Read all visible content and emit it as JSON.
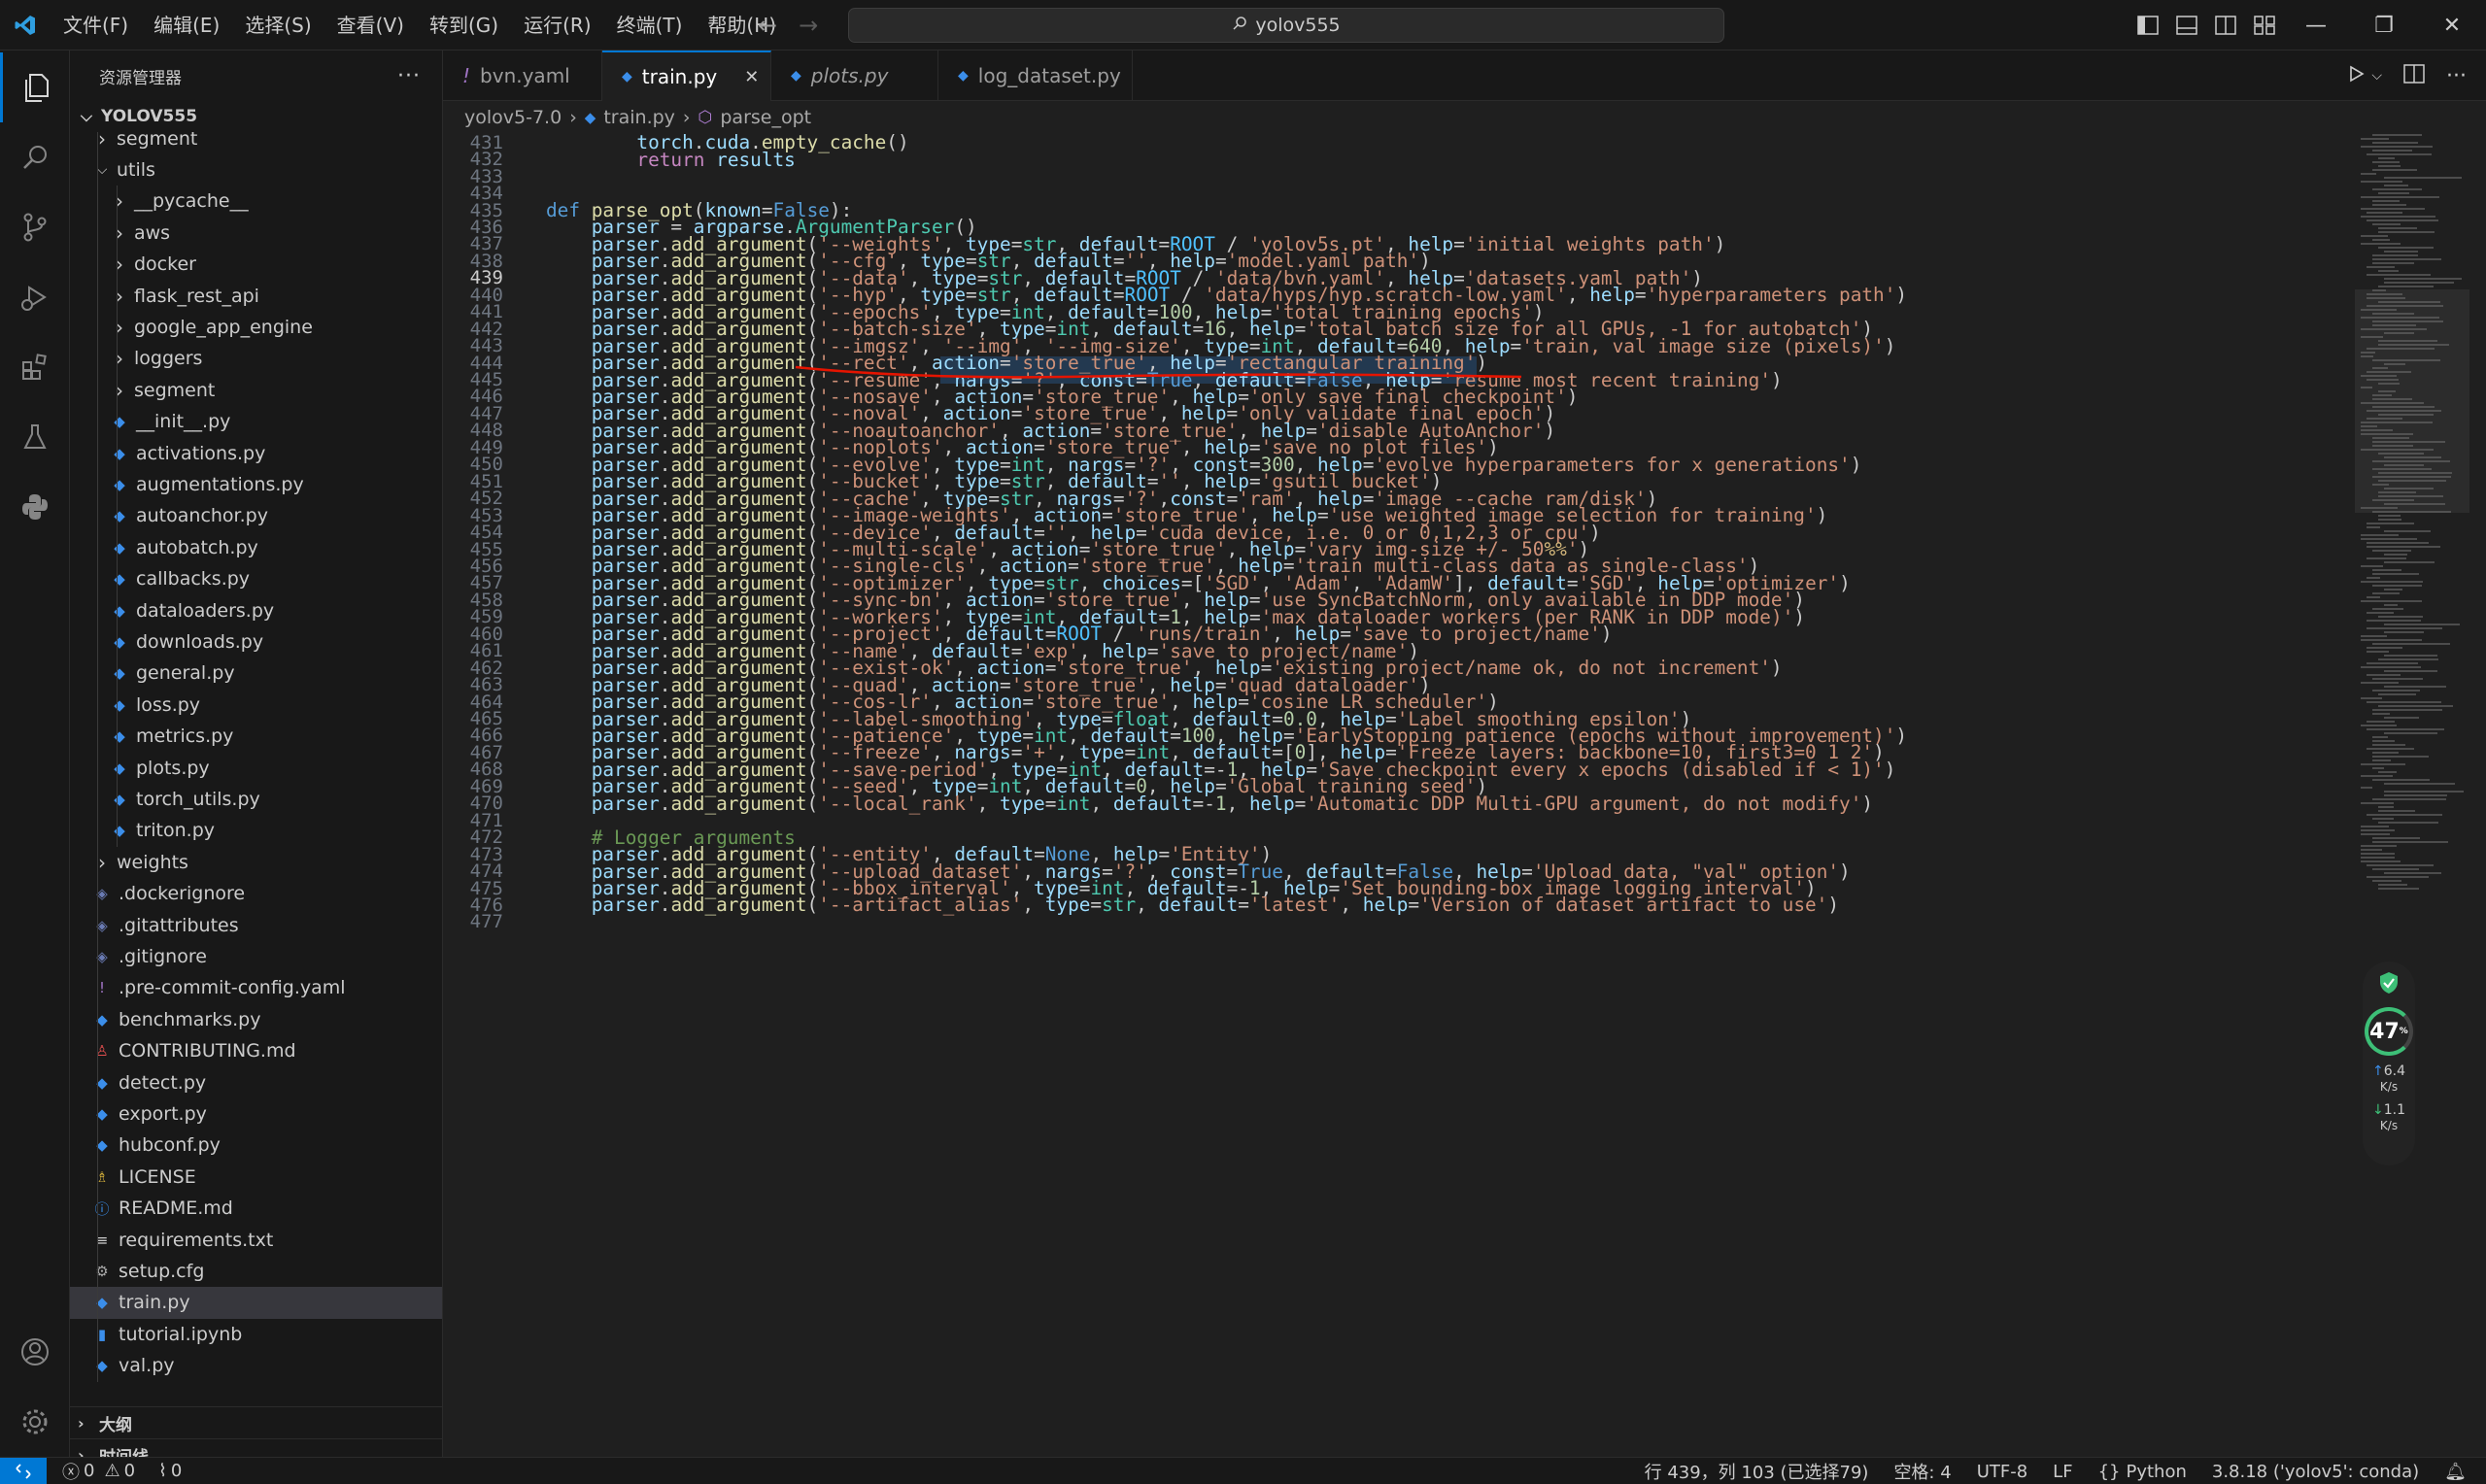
{
  "titlebar": {
    "menu": [
      "文件(F)",
      "编辑(E)",
      "选择(S)",
      "查看(V)",
      "转到(G)",
      "运行(R)",
      "终端(T)",
      "帮助(H)"
    ],
    "search": "yolov555"
  },
  "sidebar": {
    "title": "资源管理器",
    "root": "YOLOV555",
    "items": [
      {
        "label": "segment",
        "depth": 1,
        "type": "folder",
        "open": false
      },
      {
        "label": "utils",
        "depth": 1,
        "type": "folder",
        "open": true
      },
      {
        "label": "__pycache__",
        "depth": 2,
        "type": "folder",
        "open": false
      },
      {
        "label": "aws",
        "depth": 2,
        "type": "folder",
        "open": false
      },
      {
        "label": "docker",
        "depth": 2,
        "type": "folder",
        "open": false
      },
      {
        "label": "flask_rest_api",
        "depth": 2,
        "type": "folder",
        "open": false
      },
      {
        "label": "google_app_engine",
        "depth": 2,
        "type": "folder",
        "open": false
      },
      {
        "label": "loggers",
        "depth": 2,
        "type": "folder",
        "open": false
      },
      {
        "label": "segment",
        "depth": 2,
        "type": "folder",
        "open": false
      },
      {
        "label": "__init__.py",
        "depth": 2,
        "type": "py"
      },
      {
        "label": "activations.py",
        "depth": 2,
        "type": "py"
      },
      {
        "label": "augmentations.py",
        "depth": 2,
        "type": "py"
      },
      {
        "label": "autoanchor.py",
        "depth": 2,
        "type": "py"
      },
      {
        "label": "autobatch.py",
        "depth": 2,
        "type": "py"
      },
      {
        "label": "callbacks.py",
        "depth": 2,
        "type": "py"
      },
      {
        "label": "dataloaders.py",
        "depth": 2,
        "type": "py"
      },
      {
        "label": "downloads.py",
        "depth": 2,
        "type": "py"
      },
      {
        "label": "general.py",
        "depth": 2,
        "type": "py"
      },
      {
        "label": "loss.py",
        "depth": 2,
        "type": "py"
      },
      {
        "label": "metrics.py",
        "depth": 2,
        "type": "py"
      },
      {
        "label": "plots.py",
        "depth": 2,
        "type": "py"
      },
      {
        "label": "torch_utils.py",
        "depth": 2,
        "type": "py"
      },
      {
        "label": "triton.py",
        "depth": 2,
        "type": "py"
      },
      {
        "label": "weights",
        "depth": 1,
        "type": "folder",
        "open": false
      },
      {
        "label": ".dockerignore",
        "depth": 1,
        "type": "docker"
      },
      {
        "label": ".gitattributes",
        "depth": 1,
        "type": "git"
      },
      {
        "label": ".gitignore",
        "depth": 1,
        "type": "git"
      },
      {
        "label": ".pre-commit-config.yaml",
        "depth": 1,
        "type": "yaml"
      },
      {
        "label": "benchmarks.py",
        "depth": 1,
        "type": "py"
      },
      {
        "label": "CONTRIBUTING.md",
        "depth": 1,
        "type": "md"
      },
      {
        "label": "detect.py",
        "depth": 1,
        "type": "py"
      },
      {
        "label": "export.py",
        "depth": 1,
        "type": "py"
      },
      {
        "label": "hubconf.py",
        "depth": 1,
        "type": "py"
      },
      {
        "label": "LICENSE",
        "depth": 1,
        "type": "license"
      },
      {
        "label": "README.md",
        "depth": 1,
        "type": "info"
      },
      {
        "label": "requirements.txt",
        "depth": 1,
        "type": "txt"
      },
      {
        "label": "setup.cfg",
        "depth": 1,
        "type": "cfg"
      },
      {
        "label": "train.py",
        "depth": 1,
        "type": "py",
        "selected": true
      },
      {
        "label": "tutorial.ipynb",
        "depth": 1,
        "type": "nb"
      },
      {
        "label": "val.py",
        "depth": 1,
        "type": "py"
      }
    ],
    "outline": "大纲",
    "timeline": "时间线"
  },
  "tabs": [
    {
      "label": "bvn.yaml",
      "icon": "!",
      "active": false,
      "italic": false
    },
    {
      "label": "train.py",
      "icon": "py",
      "active": true,
      "italic": false
    },
    {
      "label": "plots.py",
      "icon": "py",
      "active": false,
      "italic": true
    },
    {
      "label": "log_dataset.py",
      "icon": "py",
      "active": false,
      "italic": false
    }
  ],
  "breadcrumb": {
    "folder": "yolov5-7.0",
    "file": "train.py",
    "symbol": "parse_opt"
  },
  "editor": {
    "current_line": "439",
    "lines": [
      {
        "n": "431",
        "t": "        torch.cuda.empty_cache()"
      },
      {
        "n": "432",
        "t": "        return results"
      },
      {
        "n": "433",
        "t": ""
      },
      {
        "n": "434",
        "t": ""
      },
      {
        "n": "435",
        "t": "def parse_opt(known=False):"
      },
      {
        "n": "436",
        "t": "    parser = argparse.ArgumentParser()"
      },
      {
        "n": "437",
        "t": "    parser.add_argument('--weights', type=str, default=ROOT / 'yolov5s.pt', help='initial weights path')"
      },
      {
        "n": "438",
        "t": "    parser.add_argument('--cfg', type=str, default='', help='model.yaml path')"
      },
      {
        "n": "439",
        "t": "    parser.add_argument('--data', type=str, default=ROOT / 'data/bvn.yaml', help='datasets.yaml path')"
      },
      {
        "n": "440",
        "t": "    parser.add_argument('--hyp', type=str, default=ROOT / 'data/hyps/hyp.scratch-low.yaml', help='hyperparameters path')"
      },
      {
        "n": "441",
        "t": "    parser.add_argument('--epochs', type=int, default=100, help='total training epochs')"
      },
      {
        "n": "442",
        "t": "    parser.add_argument('--batch-size', type=int, default=16, help='total batch size for all GPUs, -1 for autobatch')"
      },
      {
        "n": "443",
        "t": "    parser.add_argument('--imgsz', '--img', '--img-size', type=int, default=640, help='train, val image size (pixels)')"
      },
      {
        "n": "444",
        "t": "    parser.add_argument('--rect', action='store_true', help='rectangular training')"
      },
      {
        "n": "445",
        "t": "    parser.add_argument('--resume', nargs='?', const=True, default=False, help='resume most recent training')"
      },
      {
        "n": "446",
        "t": "    parser.add_argument('--nosave', action='store_true', help='only save final checkpoint')"
      },
      {
        "n": "447",
        "t": "    parser.add_argument('--noval', action='store_true', help='only validate final epoch')"
      },
      {
        "n": "448",
        "t": "    parser.add_argument('--noautoanchor', action='store_true', help='disable AutoAnchor')"
      },
      {
        "n": "449",
        "t": "    parser.add_argument('--noplots', action='store_true', help='save no plot files')"
      },
      {
        "n": "450",
        "t": "    parser.add_argument('--evolve', type=int, nargs='?', const=300, help='evolve hyperparameters for x generations')"
      },
      {
        "n": "451",
        "t": "    parser.add_argument('--bucket', type=str, default='', help='gsutil bucket')"
      },
      {
        "n": "452",
        "t": "    parser.add_argument('--cache', type=str, nargs='?',const='ram', help='image --cache ram/disk')"
      },
      {
        "n": "453",
        "t": "    parser.add_argument('--image-weights', action='store_true', help='use weighted image selection for training')"
      },
      {
        "n": "454",
        "t": "    parser.add_argument('--device', default='', help='cuda device, i.e. 0 or 0,1,2,3 or cpu')"
      },
      {
        "n": "455",
        "t": "    parser.add_argument('--multi-scale', action='store_true', help='vary img-size +/- 50%%')"
      },
      {
        "n": "456",
        "t": "    parser.add_argument('--single-cls', action='store_true', help='train multi-class data as single-class')"
      },
      {
        "n": "457",
        "t": "    parser.add_argument('--optimizer', type=str, choices=['SGD', 'Adam', 'AdamW'], default='SGD', help='optimizer')"
      },
      {
        "n": "458",
        "t": "    parser.add_argument('--sync-bn', action='store_true', help='use SyncBatchNorm, only available in DDP mode')"
      },
      {
        "n": "459",
        "t": "    parser.add_argument('--workers', type=int, default=1, help='max dataloader workers (per RANK in DDP mode)')"
      },
      {
        "n": "460",
        "t": "    parser.add_argument('--project', default=ROOT / 'runs/train', help='save to project/name')"
      },
      {
        "n": "461",
        "t": "    parser.add_argument('--name', default='exp', help='save to project/name')"
      },
      {
        "n": "462",
        "t": "    parser.add_argument('--exist-ok', action='store_true', help='existing project/name ok, do not increment')"
      },
      {
        "n": "463",
        "t": "    parser.add_argument('--quad', action='store_true', help='quad dataloader')"
      },
      {
        "n": "464",
        "t": "    parser.add_argument('--cos-lr', action='store_true', help='cosine LR scheduler')"
      },
      {
        "n": "465",
        "t": "    parser.add_argument('--label-smoothing', type=float, default=0.0, help='Label smoothing epsilon')"
      },
      {
        "n": "466",
        "t": "    parser.add_argument('--patience', type=int, default=100, help='EarlyStopping patience (epochs without improvement)')"
      },
      {
        "n": "467",
        "t": "    parser.add_argument('--freeze', nargs='+', type=int, default=[0], help='Freeze layers: backbone=10, first3=0 1 2')"
      },
      {
        "n": "468",
        "t": "    parser.add_argument('--save-period', type=int, default=-1, help='Save checkpoint every x epochs (disabled if < 1)')"
      },
      {
        "n": "469",
        "t": "    parser.add_argument('--seed', type=int, default=0, help='Global training seed')"
      },
      {
        "n": "470",
        "t": "    parser.add_argument('--local_rank', type=int, default=-1, help='Automatic DDP Multi-GPU argument, do not modify')"
      },
      {
        "n": "471",
        "t": ""
      },
      {
        "n": "472",
        "t": "    # Logger arguments"
      },
      {
        "n": "473",
        "t": "    parser.add_argument('--entity', default=None, help='Entity')"
      },
      {
        "n": "474",
        "t": "    parser.add_argument('--upload_dataset', nargs='?', const=True, default=False, help='Upload data, \"val\" option')"
      },
      {
        "n": "475",
        "t": "    parser.add_argument('--bbox_interval', type=int, default=-1, help='Set bounding-box image logging interval')"
      },
      {
        "n": "476",
        "t": "    parser.add_argument('--artifact_alias', type=str, default='latest', help='Version of dataset artifact to use')"
      },
      {
        "n": "477",
        "t": ""
      }
    ]
  },
  "netwidget": {
    "cpu": "47",
    "unit": "%",
    "up": "6.4",
    "down": "1.1",
    "rate_unit": "K/s"
  },
  "statusbar": {
    "errors": "0",
    "warnings": "0",
    "ports": "0",
    "position": "行 439，列 103 (已选择79)",
    "spaces": "空格: 4",
    "encoding": "UTF-8",
    "eol": "LF",
    "language": "Python",
    "interpreter": "3.8.18 ('yolov5': conda)"
  },
  "colors": {
    "accent": "#0078d4",
    "annotation": "#e51400"
  }
}
